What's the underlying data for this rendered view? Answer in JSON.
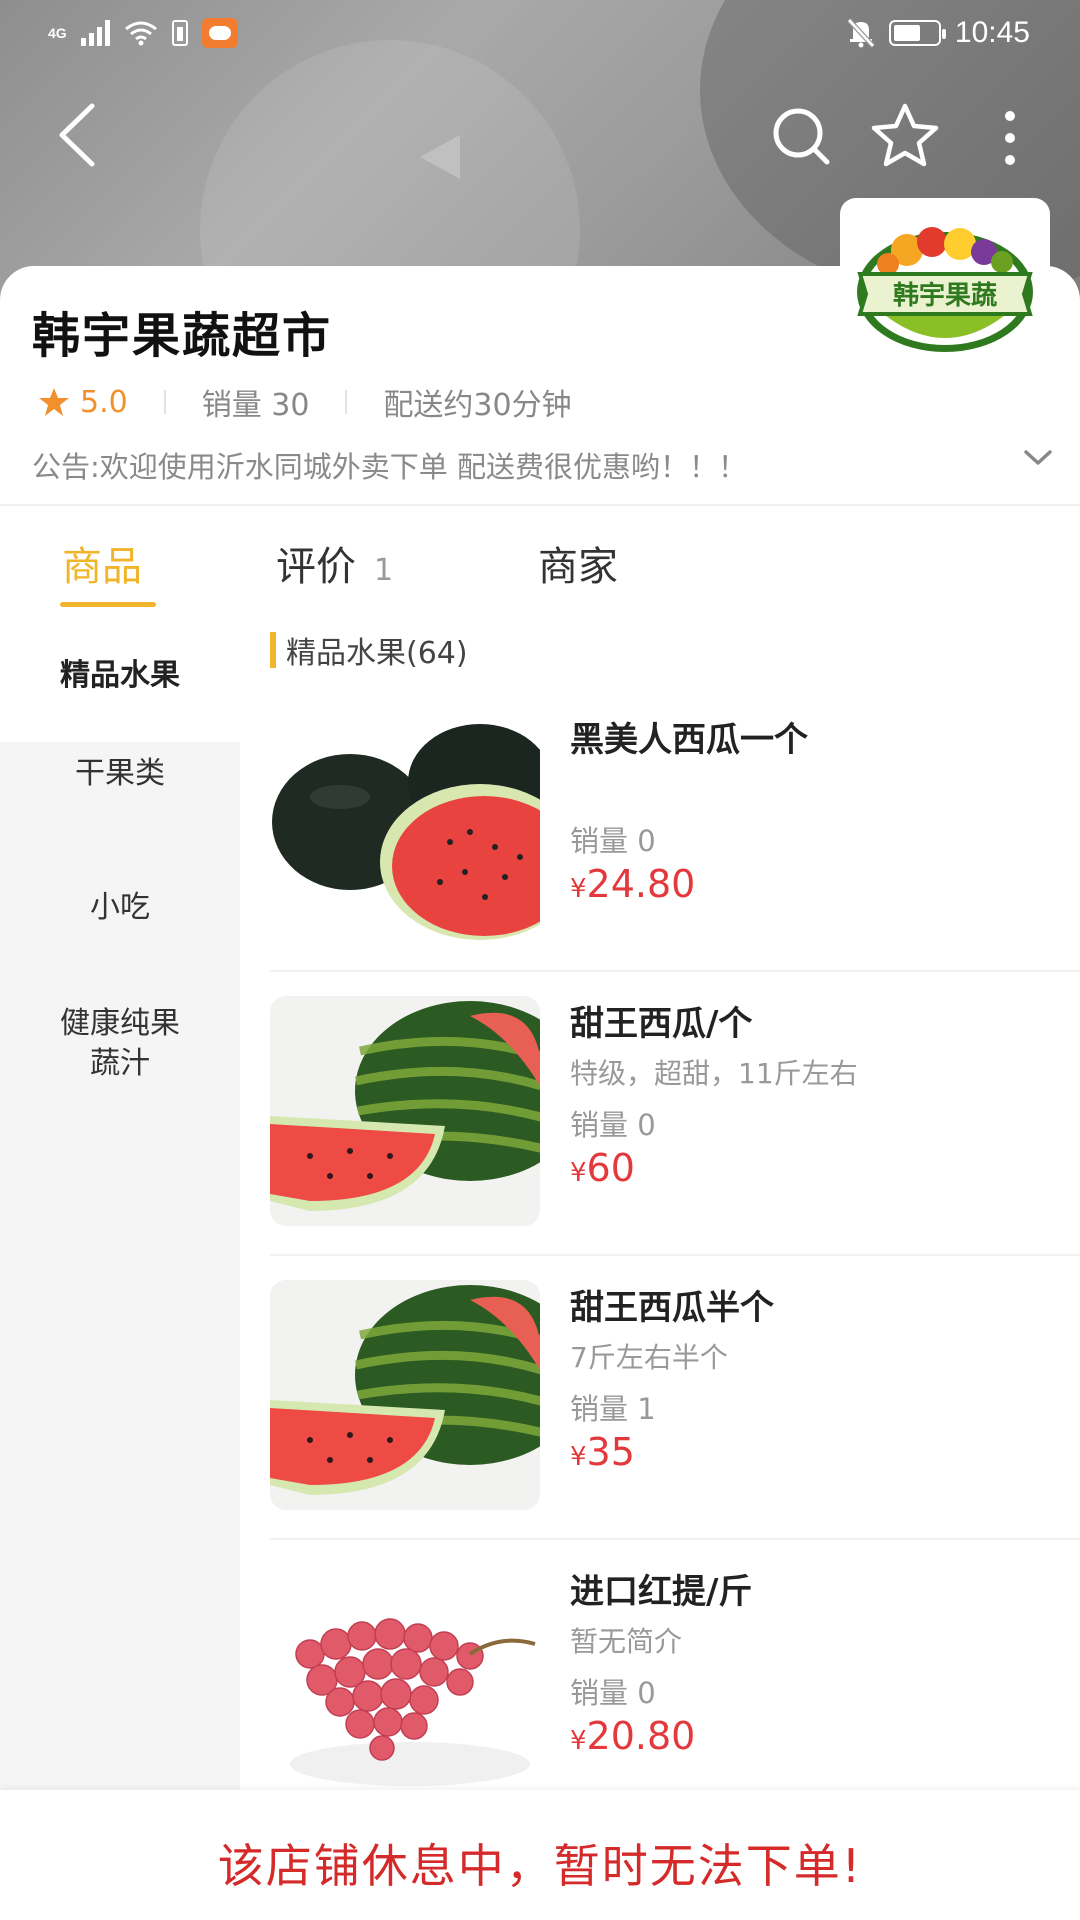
{
  "status_bar": {
    "network": "4G",
    "time": "10:45",
    "icons": [
      "signal-icon",
      "wifi-icon",
      "battery-saver-icon",
      "app-notification-icon",
      "mute-icon",
      "battery-icon"
    ]
  },
  "nav": {
    "back_icon": "back-chevron-icon",
    "search_icon": "search-icon",
    "favorite_icon": "star-outline-icon",
    "more_icon": "more-vertical-icon"
  },
  "store": {
    "name": "韩宇果蔬超市",
    "logo_text": "韩宇果蔬",
    "rating": "5.0",
    "sales": "销量 30",
    "delivery": "配送约30分钟",
    "notice": "公告:欢迎使用沂水同城外卖下单 配送费很优惠哟！！！"
  },
  "tabs": [
    {
      "label": "商品",
      "count": ""
    },
    {
      "label": "评价",
      "count": "1"
    },
    {
      "label": "商家",
      "count": ""
    }
  ],
  "categories": [
    {
      "label": "精品水果"
    },
    {
      "label": "干果类"
    },
    {
      "label": "小吃"
    },
    {
      "label": "健康纯果\n蔬汁"
    }
  ],
  "section": {
    "title": "精品水果(64)"
  },
  "products": [
    {
      "name": "黑美人西瓜一个",
      "desc": "",
      "sales": "销量 0",
      "currency": "¥",
      "price": "24.80",
      "image": "black-watermelon"
    },
    {
      "name": "甜王西瓜/个",
      "desc": "特级，超甜，11斤左右",
      "sales": "销量 0",
      "currency": "¥",
      "price": "60",
      "image": "striped-watermelon"
    },
    {
      "name": "甜王西瓜半个",
      "desc": "7斤左右半个",
      "sales": "销量 1",
      "currency": "¥",
      "price": "35",
      "image": "striped-watermelon"
    },
    {
      "name": "进口红提/斤",
      "desc": "暂无简介",
      "sales": "销量 0",
      "currency": "¥",
      "price": "20.80",
      "image": "red-grapes"
    }
  ],
  "bottom": {
    "message": "该店铺休息中，暂时无法下单!"
  },
  "colors": {
    "accent": "#f1b52b",
    "price": "#e4393c",
    "rating": "#f0912e",
    "closed_text": "#d42a2a",
    "sidebar_bg": "#f5f5f5"
  }
}
